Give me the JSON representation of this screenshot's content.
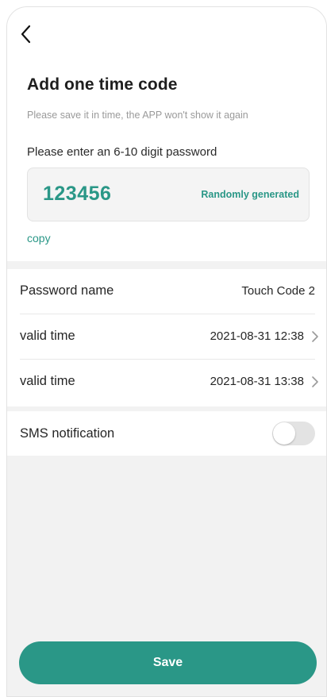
{
  "header": {
    "back_icon": "chevron-left-icon",
    "title": "Add one time code",
    "subtitle": "Please save it in time, the APP won't show it again"
  },
  "password_input": {
    "prompt": "Please enter an 6-10 digit password",
    "value": "123456",
    "random_label": "Randomly generated",
    "copy_label": "copy"
  },
  "settings": {
    "rows": [
      {
        "label": "Password name",
        "value": "Touch Code 2"
      },
      {
        "label": "valid time",
        "value": "2021-08-31 12:38"
      },
      {
        "label": "valid time",
        "value": "2021-08-31 13:38"
      }
    ],
    "sms": {
      "label": "SMS notification",
      "enabled": false
    }
  },
  "footer": {
    "save_label": "Save"
  },
  "colors": {
    "accent": "#2a9787",
    "background": "#f2f2f2"
  }
}
